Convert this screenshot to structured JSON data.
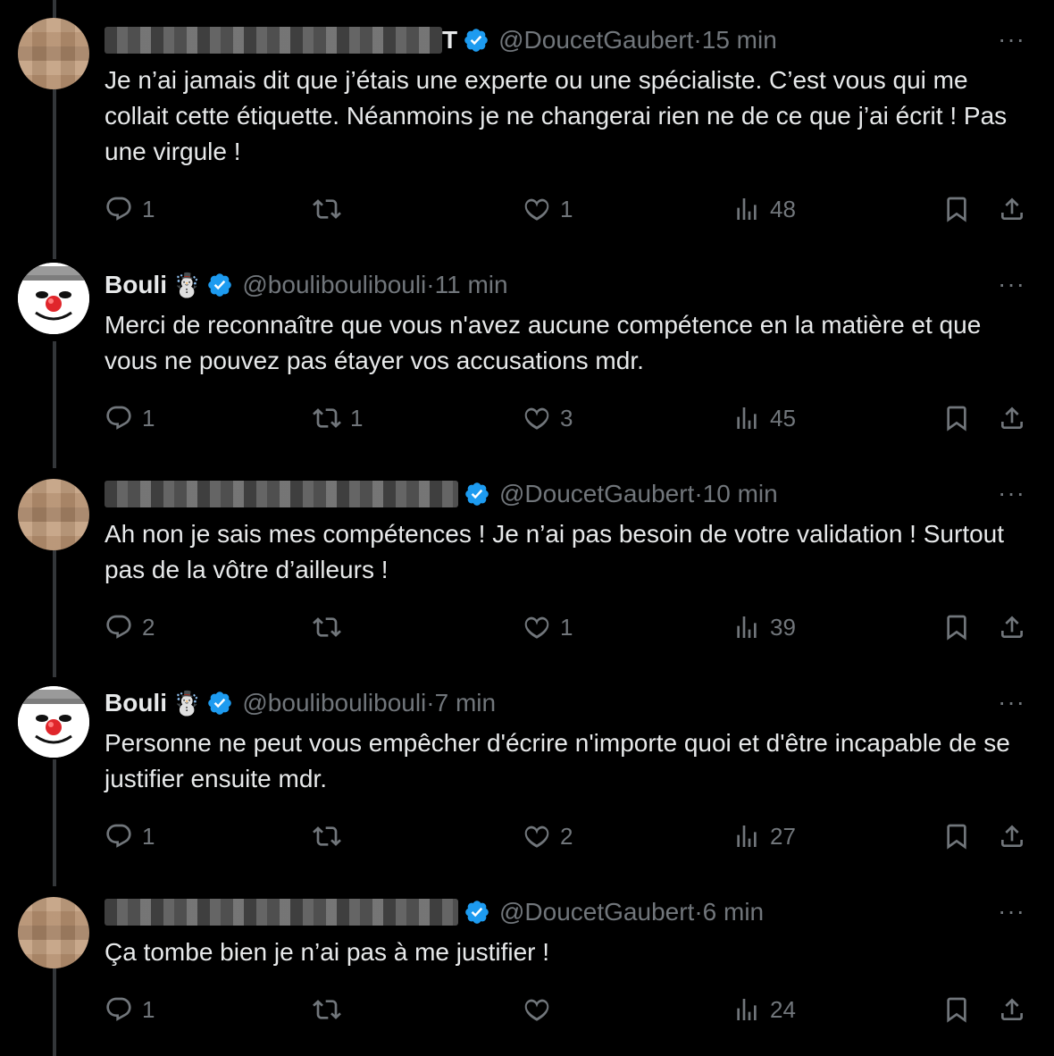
{
  "tweets": [
    {
      "author": "blurred",
      "name": "T",
      "handle": "@DoucetGaubert",
      "time": "15 min",
      "text": "Je n’ai jamais dit que j’étais une experte ou une spécialiste. C’est vous qui me collait cette étiquette. Néanmoins je ne changerai rien ne de ce que j’ai écrit ! Pas une virgule !",
      "replies": "1",
      "retweets": "",
      "likes": "1",
      "views": "48"
    },
    {
      "author": "bouli",
      "name": "Bouli",
      "emoji": "☃️",
      "handle": "@bouliboulibouli",
      "time": "11 min",
      "text": "Merci de reconnaître que vous n'avez aucune compétence en la matière et que vous ne pouvez pas étayer vos accusations mdr.",
      "replies": "1",
      "retweets": "1",
      "likes": "3",
      "views": "45"
    },
    {
      "author": "blurred",
      "name": "",
      "handle": "@DoucetGaubert",
      "time": "10 min",
      "text": "Ah non je sais mes compétences ! Je n’ai pas besoin de votre validation ! Surtout pas de la vôtre d’ailleurs !",
      "replies": "2",
      "retweets": "",
      "likes": "1",
      "views": "39"
    },
    {
      "author": "bouli",
      "name": "Bouli",
      "emoji": "☃️",
      "handle": "@bouliboulibouli",
      "time": "7 min",
      "text": "Personne ne peut vous empêcher d'écrire n'importe quoi et d'être incapable de se justifier ensuite mdr.",
      "replies": "1",
      "retweets": "",
      "likes": "2",
      "views": "27"
    },
    {
      "author": "blurred",
      "name": "",
      "handle": "@DoucetGaubert",
      "time": "6 min",
      "text": "Ça tombe bien je n’ai pas à me justifier !",
      "replies": "1",
      "retweets": "",
      "likes": "",
      "views": "24"
    }
  ],
  "separator": " · ",
  "more_label": "···",
  "colors": {
    "background": "#000000",
    "text": "#e7e9ea",
    "muted": "#71767b",
    "verified": "#1d9bf0"
  }
}
